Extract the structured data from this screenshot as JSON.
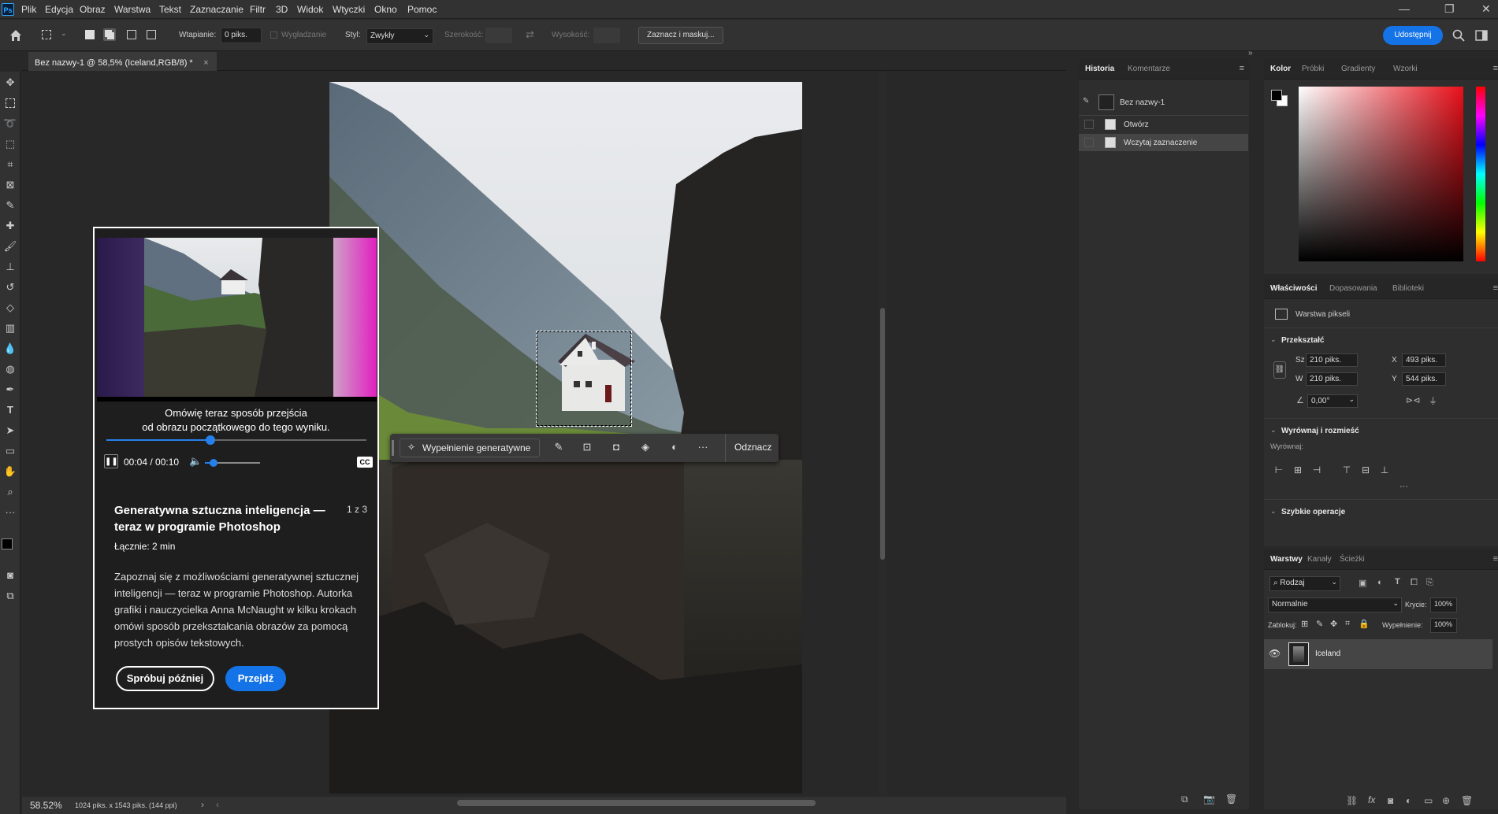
{
  "app": {
    "logo": "Ps"
  },
  "menu": [
    "Plik",
    "Edycja",
    "Obraz",
    "Warstwa",
    "Tekst",
    "Zaznaczanie",
    "Filtr",
    "3D",
    "Widok",
    "Wtyczki",
    "Okno",
    "Pomoc"
  ],
  "window_controls": {
    "minimize": "—",
    "maximize": "❐",
    "close": "✕"
  },
  "options": {
    "feather_label": "Wtapianie:",
    "feather_value": "0 piks.",
    "antialias_label": "Wygładzanie",
    "style_label": "Styl:",
    "style_value": "Zwykły",
    "width_label": "Szerokość:",
    "height_label": "Wysokość:",
    "select_mask_button": "Zaznacz i maskuj...",
    "share_button": "Udostępnij"
  },
  "document_tab": {
    "title": "Bez nazwy-1 @ 58,5% (Iceland,RGB/8) *",
    "close": "×"
  },
  "status": {
    "zoom": "58.52%",
    "info": "1024 piks. x 1543 piks. (144 ppi)",
    "arrow": "›",
    "left_arrow": "‹"
  },
  "context_bar": {
    "generative_fill": "Wypełnienie generatywne",
    "deselect": "Odznacz",
    "more": "···"
  },
  "tutorial": {
    "caption_line1": "Omówię teraz sposób przejścia",
    "caption_line2": "od obrazu początkowego do tego wyniku.",
    "progress": 0.4,
    "time": "00:04 / 00:10",
    "volume": 0.15,
    "cc": "CC",
    "pause": "❚❚",
    "title": "Generatywna sztuczna inteligencja — teraz w programie Photoshop",
    "count": "1 z 3",
    "total": "Łącznie: 2 min",
    "description": "Zapoznaj się z możliwościami generatywnej sztucznej inteligencji — teraz w programie Photoshop. Autorka grafiki i nauczycielka Anna McNaught w kilku krokach omówi sposób przekształcania obrazów za pomocą prostych opisów tekstowych.",
    "later_button": "Spróbuj później",
    "go_button": "Przejdź"
  },
  "history_panel": {
    "tabs": [
      "Historia",
      "Komentarze"
    ],
    "snapshot": "Bez nazwy-1",
    "steps": [
      "Otwórz",
      "Wczytaj zaznaczenie"
    ]
  },
  "color_panel": {
    "tabs": [
      "Kolor",
      "Próbki",
      "Gradienty",
      "Wzorki"
    ],
    "hue_color": "#e8101a"
  },
  "properties_panel": {
    "tabs": [
      "Właściwości",
      "Dopasowania",
      "Biblioteki"
    ],
    "layer_type": "Warstwa pikseli",
    "transform_title": "Przekształć",
    "w_label": "Sz",
    "w_value": "210 piks.",
    "h_label": "W",
    "h_value": "210 piks.",
    "x_label": "X",
    "x_value": "493 piks.",
    "y_label": "Y",
    "y_value": "544 piks.",
    "angle_value": "0,00°",
    "align_title": "Wyrównaj i rozmieść",
    "align_label": "Wyrównaj:",
    "quick_title": "Szybkie operacje",
    "more": "···"
  },
  "layers_panel": {
    "tabs": [
      "Warstwy",
      "Kanały",
      "Ścieżki"
    ],
    "filter_value": "Rodzaj",
    "blend_mode": "Normalnie",
    "opacity_label": "Krycie:",
    "opacity_value": "100%",
    "lock_label": "Zablokuj:",
    "fill_label": "Wypełnienie:",
    "fill_value": "100%",
    "layer_name": "Iceland"
  }
}
